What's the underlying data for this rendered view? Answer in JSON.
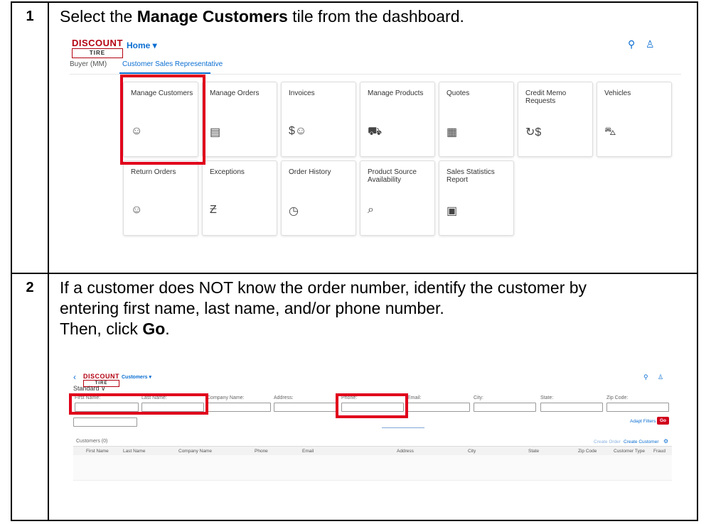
{
  "steps": [
    {
      "number": "1",
      "text_pre": "Select the ",
      "text_bold": "Manage Customers",
      "text_post": " tile from the dashboard."
    },
    {
      "number": "2",
      "line1": "If a customer does NOT know the order number, identify the customer by",
      "line2": "entering first name, last name, and/or phone number.",
      "line3_pre": "Then, click ",
      "line3_bold": "Go",
      "line3_post": "."
    }
  ],
  "shot1": {
    "logo_main": "DISCOUNT",
    "logo_sub": "TIRE",
    "home_menu": "Home ▾",
    "search_icon": "⚲",
    "user_icon": "♙",
    "tabs": [
      "Buyer (MM)",
      "Customer Sales Representative"
    ],
    "tiles_row1": [
      {
        "title": "Manage Customers",
        "icon": "☺"
      },
      {
        "title": "Manage Orders",
        "icon": "▤"
      },
      {
        "title": "Invoices",
        "icon": "$☺"
      },
      {
        "title": "Manage Products",
        "icon": "⛟"
      },
      {
        "title": "Quotes",
        "icon": "▦"
      },
      {
        "title": "Credit Memo Requests",
        "icon": "↻$"
      },
      {
        "title": "Vehicles",
        "icon": "⛍"
      }
    ],
    "tiles_row2": [
      {
        "title": "Return Orders",
        "icon": "☺"
      },
      {
        "title": "Exceptions",
        "icon": "Ƶ"
      },
      {
        "title": "Order History",
        "icon": "◷"
      },
      {
        "title": "Product Source Availability",
        "icon": "⌕"
      },
      {
        "title": "Sales Statistics Report",
        "icon": "▣"
      }
    ]
  },
  "shot2": {
    "back": "‹",
    "logo_main": "DISCOUNT",
    "logo_sub": "TIRE",
    "customers_menu": "Customers ▾",
    "search_icon": "⚲",
    "user_icon": "♙",
    "variant": "Standard ∨",
    "filters": [
      "First Name:",
      "Last Name:",
      "Company Name:",
      "Address:",
      "Phone:",
      "Email:",
      "City:",
      "State:",
      "Zip Code:"
    ],
    "adapt_filters": "Adapt Filters",
    "go": "Go",
    "customers_count": "Customers (0)",
    "create_order": "Create Order",
    "create_customer": "Create Customer",
    "settings_icon": "⚙",
    "columns": [
      "First Name",
      "Last Name",
      "Company Name",
      "Phone",
      "Email",
      "Address",
      "City",
      "State",
      "Zip Code",
      "Customer Type",
      "Fraud"
    ]
  },
  "colors": {
    "highlight": "#e0001b",
    "fiori_blue": "#0a6ed1",
    "brand_red": "#b30010"
  }
}
